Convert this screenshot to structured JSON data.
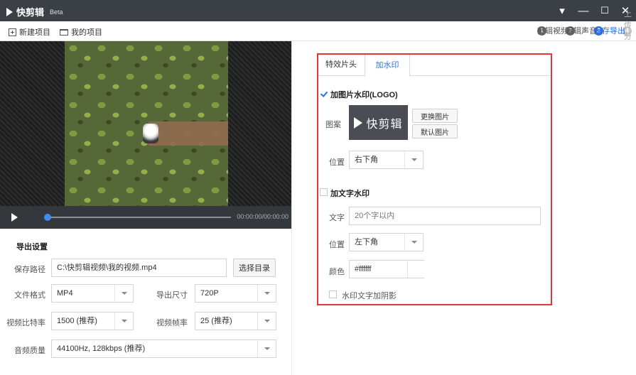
{
  "app": {
    "name": "快剪辑",
    "badge": "Beta"
  },
  "window_controls": {
    "menu": "▾",
    "minimize": "—",
    "maximize": "☐",
    "close": "✕"
  },
  "menu": {
    "new_project": "新建项目",
    "my_projects": "我的项目"
  },
  "steps": [
    {
      "num": "1",
      "label": "剪辑视频",
      "state": "done"
    },
    {
      "num": "2",
      "label": "编辑声音",
      "state": "done"
    },
    {
      "num": "3",
      "label": "保存导出",
      "state": "active"
    },
    {
      "num": "4",
      "label": "上传分享",
      "state": "disabled"
    }
  ],
  "step_separator": ">",
  "player": {
    "time": "00:00:00/00:00:00",
    "progress": 0
  },
  "export": {
    "title": "导出设置",
    "save_path_label": "保存路径",
    "save_path_value": "C:\\快剪辑视频\\我的视频.mp4",
    "choose_dir_button": "选择目录",
    "format_label": "文件格式",
    "format_value": "MP4",
    "size_label": "导出尺寸",
    "size_value": "720P",
    "bitrate_label": "视频比特率",
    "bitrate_value": "1500 (推荐)",
    "fps_label": "视频帧率",
    "fps_value": "25 (推荐)",
    "audio_label": "音频质量",
    "audio_value": "44100Hz, 128kbps (推荐)"
  },
  "watermark": {
    "tabs": [
      {
        "label": "特效片头",
        "active": false
      },
      {
        "label": "加水印",
        "active": true
      }
    ],
    "image_wm": {
      "checked": true,
      "label": "加图片水印(LOGO)",
      "pattern_label": "图案",
      "logo_text": "快剪辑",
      "replace_button": "更换图片",
      "default_button": "默认图片",
      "position_label": "位置",
      "position_value": "右下角"
    },
    "text_wm": {
      "checked": false,
      "label": "加文字水印",
      "text_label": "文字",
      "text_placeholder": "20个字以内",
      "position_label": "位置",
      "position_value": "左下角",
      "color_label": "颜色",
      "color_value": "#ffffff",
      "shadow_checked": false,
      "shadow_label": "水印文字加阴影"
    }
  },
  "colors": {
    "accent": "#2a6fe6",
    "highlight_border": "#e53535",
    "titlebar": "#3b3f46"
  }
}
